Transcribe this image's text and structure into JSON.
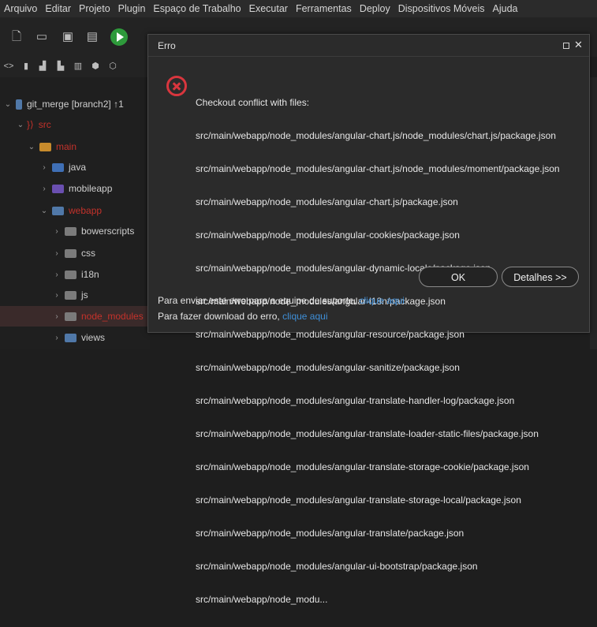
{
  "menubar": {
    "items": [
      "Arquivo",
      "Editar",
      "Projeto",
      "Plugin",
      "Espaço de Trabalho",
      "Executar",
      "Ferramentas",
      "Deploy",
      "Dispositivos Móveis",
      "Ajuda"
    ]
  },
  "toolbar": {
    "icons": [
      "new-file-icon",
      "open-folder-icon",
      "save-icon",
      "save-all-icon",
      "run-icon"
    ]
  },
  "toolbar2": {
    "icons": [
      "code-icon",
      "file-icon",
      "chart-icon",
      "layers-icon",
      "server-icon",
      "html5-icon",
      "css-icon"
    ]
  },
  "tree": {
    "project": "git_merge [branch2] ↑1",
    "items": [
      {
        "label": "src",
        "color": "#c4322b"
      },
      {
        "label": "main",
        "color": "#c4322b"
      },
      {
        "label": "java",
        "color": "#cfcfcf"
      },
      {
        "label": "mobileapp",
        "color": "#cfcfcf"
      },
      {
        "label": "webapp",
        "color": "#c4322b"
      },
      {
        "label": "bowerscripts",
        "color": "#cfcfcf"
      },
      {
        "label": "css",
        "color": "#cfcfcf"
      },
      {
        "label": "i18n",
        "color": "#cfcfcf"
      },
      {
        "label": "js",
        "color": "#cfcfcf"
      },
      {
        "label": "node_modules",
        "color": "#c4322b"
      },
      {
        "label": "views",
        "color": "#cfcfcf"
      }
    ]
  },
  "dialog": {
    "title": "Erro",
    "message_lines": [
      "Checkout conflict with files:",
      "src/main/webapp/node_modules/angular-chart.js/node_modules/chart.js/package.json",
      "src/main/webapp/node_modules/angular-chart.js/node_modules/moment/package.json",
      "src/main/webapp/node_modules/angular-chart.js/package.json",
      "src/main/webapp/node_modules/angular-cookies/package.json",
      "src/main/webapp/node_modules/angular-dynamic-locale/package.json",
      "src/main/webapp/node_modules/angular-i18n/package.json",
      "src/main/webapp/node_modules/angular-resource/package.json",
      "src/main/webapp/node_modules/angular-sanitize/package.json",
      "src/main/webapp/node_modules/angular-translate-handler-log/package.json",
      "src/main/webapp/node_modules/angular-translate-loader-static-files/package.json",
      "src/main/webapp/node_modules/angular-translate-storage-cookie/package.json",
      "src/main/webapp/node_modules/angular-translate-storage-local/package.json",
      "src/main/webapp/node_modules/angular-translate/package.json",
      "src/main/webapp/node_modules/angular-ui-bootstrap/package.json",
      "src/main/webapp/node_modu..."
    ],
    "ok_label": "OK",
    "details_label": "Detalhes >>",
    "support_text": "Para enviar este erro para a equipe de suporte,",
    "support_link": "clique aqui",
    "download_text": "Para fazer download do erro,",
    "download_link": "clique aqui"
  }
}
